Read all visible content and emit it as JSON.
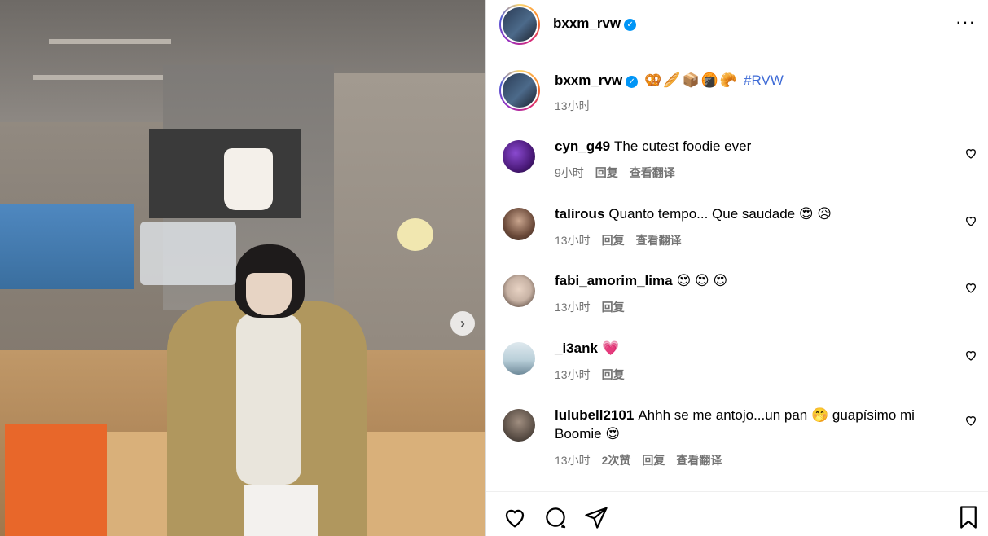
{
  "post": {
    "image_alt": "Person in a beige coat holding up a bakery bag in a cafe"
  },
  "header": {
    "username": "bxxm_rvw",
    "verified": true,
    "more_label": "···"
  },
  "caption": {
    "username": "bxxm_rvw",
    "emojis": "🥨🥖📦🍘🥐",
    "hashtag": "#RVW",
    "time": "13小时"
  },
  "comments": [
    {
      "user": "cyn_g49",
      "text": "The cutest foodie ever",
      "time": "9小时",
      "likes": "",
      "reply": "回复",
      "translate": "查看翻译",
      "avatar_color": "#4b1a7a"
    },
    {
      "user": "talirous",
      "text": "Quanto tempo... Que saudade 😍 😥",
      "time": "13小时",
      "likes": "",
      "reply": "回复",
      "translate": "查看翻译",
      "avatar_color": "#6b4a3a"
    },
    {
      "user": "fabi_amorim_lima",
      "text": "😍 😍 😍",
      "time": "13小时",
      "likes": "",
      "reply": "回复",
      "translate": "",
      "avatar_color": "#c7b2a4"
    },
    {
      "user": "_i3ank",
      "text": "💗",
      "time": "13小时",
      "likes": "",
      "reply": "回复",
      "translate": "",
      "avatar_color": "#b9cfd9"
    },
    {
      "user": "lulubell2101",
      "text": "Ahhh se me antojo...un pan 🤭 guapísimo mi Boomie 😍",
      "time": "13小时",
      "likes": "2次赞",
      "reply": "回复",
      "translate": "查看翻译",
      "avatar_color": "#5d5148"
    }
  ],
  "icons": {
    "like": "heart-icon",
    "comment": "comment-icon",
    "share": "share-icon",
    "save": "bookmark-icon",
    "next": "chevron-right-icon"
  }
}
